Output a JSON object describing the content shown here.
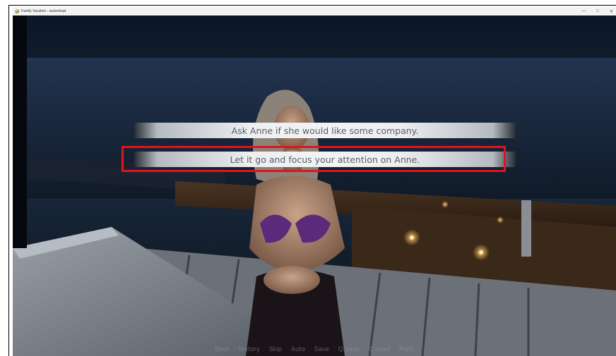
{
  "window": {
    "title": "Family Vacation - autoreload",
    "controls": [
      "—",
      "□",
      "✕"
    ]
  },
  "choices": [
    {
      "label": "Ask Anne if she would like some company."
    },
    {
      "label": "Let it go and focus your attention on Anne."
    }
  ],
  "quick_menu": [
    "Back",
    "History",
    "Skip",
    "Auto",
    "Save",
    "Q.Save",
    "Q.Load",
    "Prefs"
  ],
  "colors": {
    "highlight": "#e1141d",
    "choice_text": "#5a5e66"
  }
}
